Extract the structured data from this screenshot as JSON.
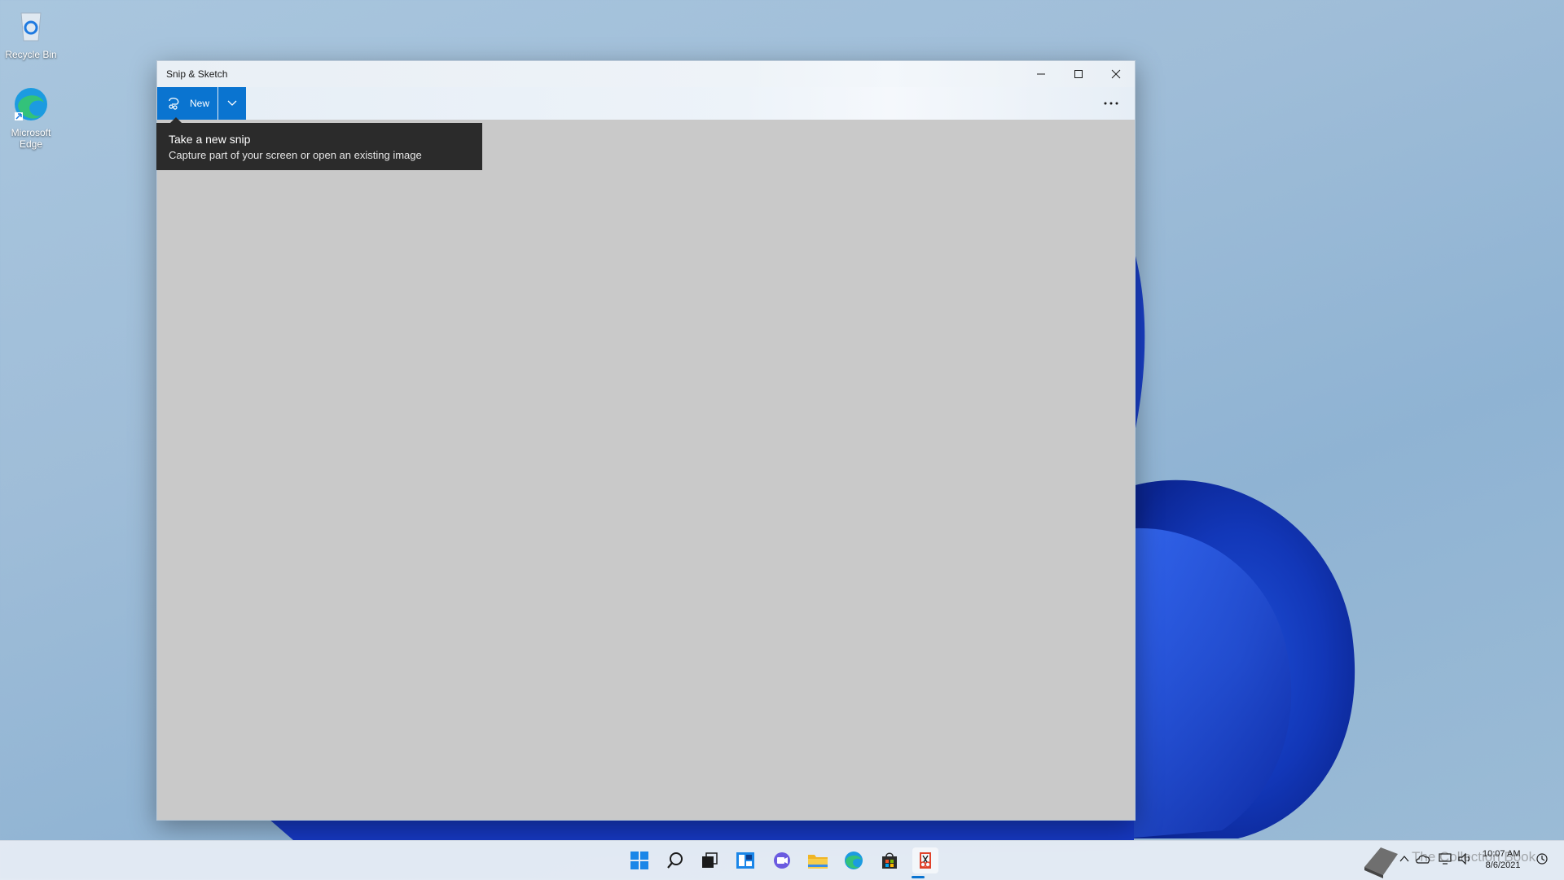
{
  "desktop": {
    "icons": [
      {
        "label": "Recycle Bin"
      },
      {
        "label": "Microsoft Edge"
      }
    ]
  },
  "window": {
    "title": "Snip & Sketch",
    "toolbar": {
      "new_label": "New"
    },
    "tooltip": {
      "title": "Take a new snip",
      "description": "Capture part of your screen or open an existing image"
    }
  },
  "taskbar": {
    "clock_time": "10:07 AM",
    "clock_date": "8/6/2021",
    "watermark": "The Collection Book",
    "pinned": [
      "start-icon",
      "search-icon",
      "task-view-icon",
      "widgets-icon",
      "chat-icon",
      "file-explorer-icon",
      "edge-icon",
      "store-icon",
      "snip-sketch-icon"
    ]
  },
  "colors": {
    "accent": "#0a74d0",
    "tooltip_bg": "#2b2b2b",
    "canvas_bg": "#c9c9c9"
  }
}
